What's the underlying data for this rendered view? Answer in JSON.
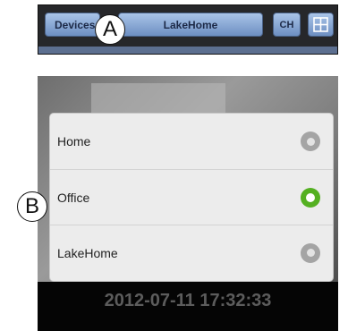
{
  "toolbar": {
    "devices_label": "Devices",
    "title": "LakeHome",
    "ch_label": "CH",
    "grid_icon": "grid-icon"
  },
  "callouts": {
    "a": "A",
    "b": "B"
  },
  "dialog": {
    "options": [
      {
        "label": "Home",
        "selected": false
      },
      {
        "label": "Office",
        "selected": true
      },
      {
        "label": "LakeHome",
        "selected": false
      }
    ]
  },
  "camera": {
    "timestamp": "2012-07-11 17:32:33"
  },
  "colors": {
    "selected": "#54b021",
    "unselected": "#a4a4a4",
    "toolbar_button": "#8fb0dc"
  }
}
